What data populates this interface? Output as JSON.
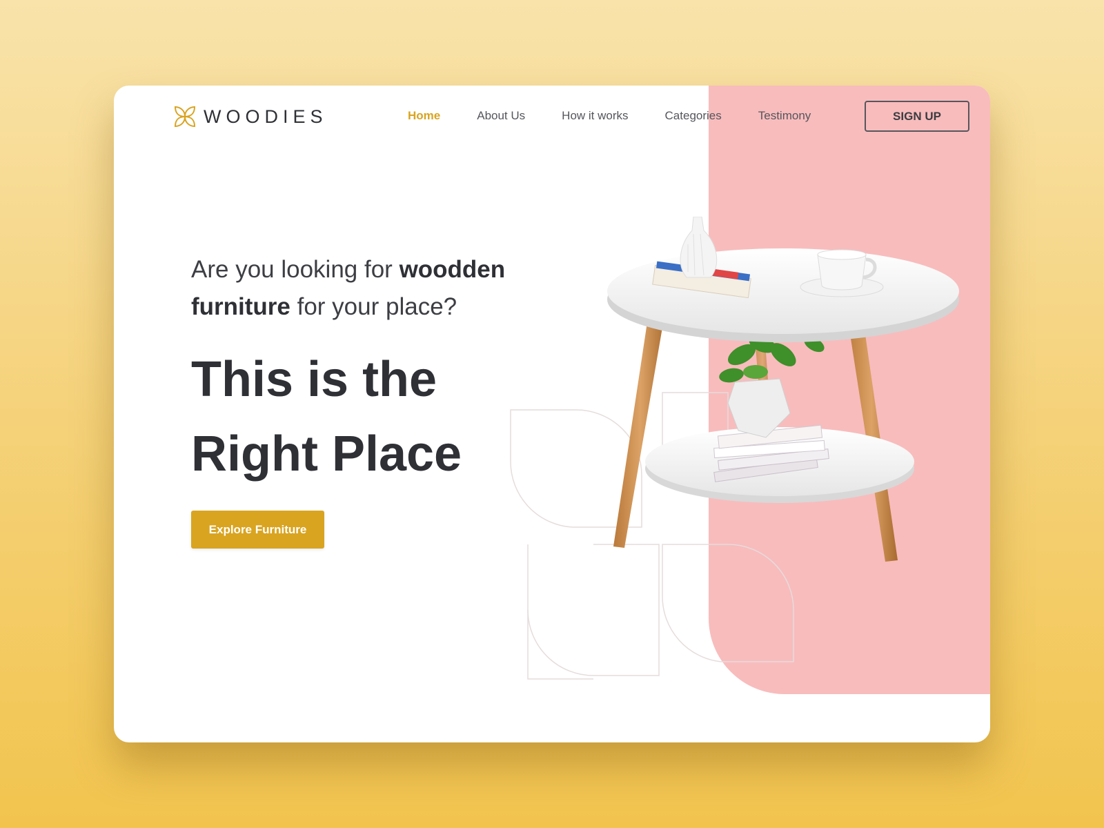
{
  "brand": {
    "name": "WOODIES",
    "accent_color": "#d9a420",
    "panel_color": "#f8bcbd"
  },
  "nav": {
    "items": [
      {
        "label": "Home",
        "active": true
      },
      {
        "label": "About Us",
        "active": false
      },
      {
        "label": "How it works",
        "active": false
      },
      {
        "label": "Categories",
        "active": false
      },
      {
        "label": "Testimony",
        "active": false
      }
    ],
    "signup_label": "SIGN UP"
  },
  "hero": {
    "question_part1": "Are you looking for ",
    "question_bold1": "woodden",
    "question_bold2": "furniture",
    "question_part2": " for your place?",
    "headline_line1": "This is the",
    "headline_line2": "Right Place",
    "cta_label": "Explore Furniture"
  },
  "illustration": {
    "name": "side-table-with-vase-cup-plant-books"
  }
}
